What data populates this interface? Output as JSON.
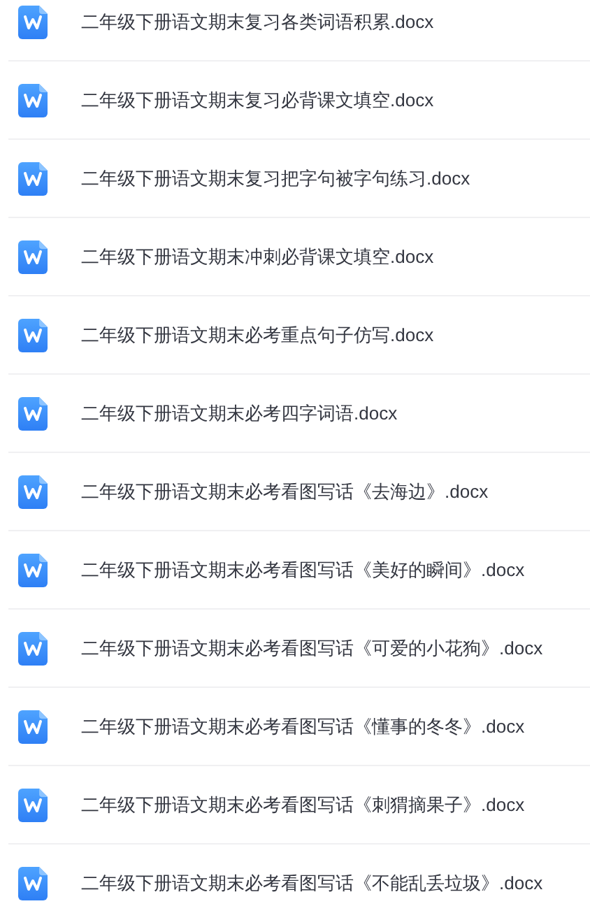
{
  "files": [
    {
      "name": "二年级下册语文期末复习各类词语积累.docx"
    },
    {
      "name": "二年级下册语文期末复习必背课文填空.docx"
    },
    {
      "name": "二年级下册语文期末复习把字句被字句练习.docx"
    },
    {
      "name": "二年级下册语文期末冲刺必背课文填空.docx"
    },
    {
      "name": "二年级下册语文期末必考重点句子仿写.docx"
    },
    {
      "name": "二年级下册语文期末必考四字词语.docx"
    },
    {
      "name": "二年级下册语文期末必考看图写话《去海边》.docx"
    },
    {
      "name": "二年级下册语文期末必考看图写话《美好的瞬间》.docx"
    },
    {
      "name": "二年级下册语文期末必考看图写话《可爱的小花狗》.docx"
    },
    {
      "name": "二年级下册语文期末必考看图写话《懂事的冬冬》.docx"
    },
    {
      "name": "二年级下册语文期末必考看图写话《刺猬摘果子》.docx"
    },
    {
      "name": "二年级下册语文期末必考看图写话《不能乱丢垃圾》.docx"
    }
  ]
}
